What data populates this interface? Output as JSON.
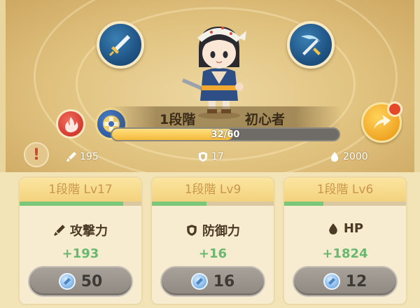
{
  "rank": {
    "tier": "1段階",
    "title": "初心者",
    "exp_current": 32,
    "exp_max": 60,
    "exp_text": "32/60"
  },
  "stats": {
    "attack": "195",
    "defense": "17",
    "hp": "2000"
  },
  "cards": [
    {
      "level": "1段階 Lv17",
      "progress": 0.85,
      "label": "攻撃力",
      "icon": "sword-icon",
      "bonus": "+193",
      "cost": "50"
    },
    {
      "level": "1段階 Lv9",
      "progress": 0.45,
      "label": "防御力",
      "icon": "shield-icon",
      "bonus": "+16",
      "cost": "16"
    },
    {
      "level": "1段階 Lv6",
      "progress": 0.32,
      "label": "HP",
      "icon": "drop-icon",
      "bonus": "+1824",
      "cost": "12"
    }
  ],
  "colors": {
    "bar_fill": "#f4b93a",
    "card_progress": "#7bc77a",
    "bonus_text": "#6ab870",
    "notify": "#e44a2a"
  }
}
